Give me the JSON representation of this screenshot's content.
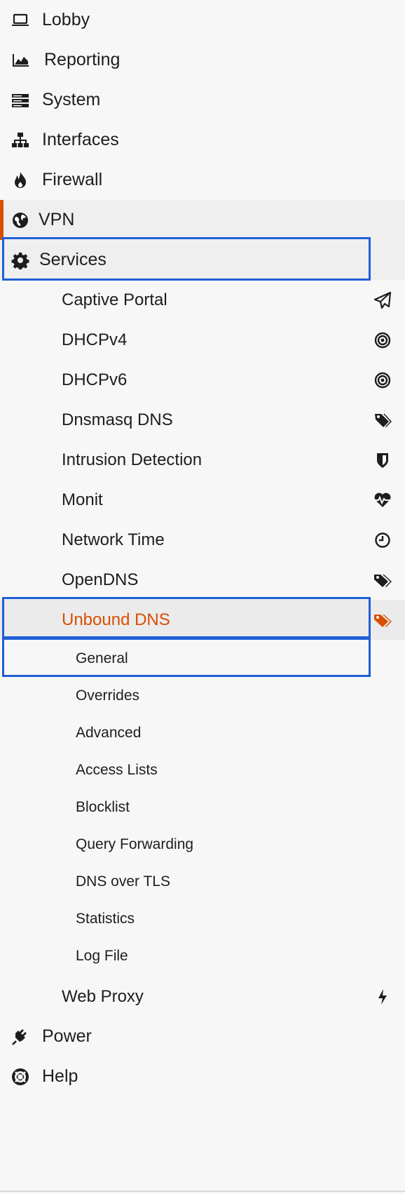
{
  "menu": {
    "lobby": "Lobby",
    "reporting": "Reporting",
    "system": "System",
    "interfaces": "Interfaces",
    "firewall": "Firewall",
    "vpn": "VPN",
    "services": "Services",
    "power": "Power",
    "help": "Help"
  },
  "services": {
    "captive_portal": "Captive Portal",
    "dhcpv4": "DHCPv4",
    "dhcpv6": "DHCPv6",
    "dnsmasq": "Dnsmasq DNS",
    "intrusion": "Intrusion Detection",
    "monit": "Monit",
    "network_time": "Network Time",
    "opendns": "OpenDNS",
    "unbound": "Unbound DNS",
    "web_proxy": "Web Proxy"
  },
  "unbound_items": {
    "general": "General",
    "overrides": "Overrides",
    "advanced": "Advanced",
    "access_lists": "Access Lists",
    "blocklist": "Blocklist",
    "query_forwarding": "Query Forwarding",
    "dns_over_tls": "DNS over TLS",
    "statistics": "Statistics",
    "log_file": "Log File"
  },
  "colors": {
    "accent": "#d94f00",
    "highlight_box": "#1f5fd6"
  },
  "icons": {
    "lobby": "laptop-icon",
    "reporting": "area-chart-icon",
    "system": "server-icon",
    "interfaces": "sitemap-icon",
    "firewall": "fire-icon",
    "vpn": "globe-icon",
    "services": "gear-icon",
    "captive_portal": "paper-plane-icon",
    "dhcp": "bullseye-icon",
    "tag": "tag-icon",
    "shield": "shield-icon",
    "heartbeat": "heartbeat-icon",
    "clock": "clock-icon",
    "tags": "tags-icon",
    "bolt": "bolt-icon",
    "power": "plug-icon",
    "help": "life-ring-icon"
  }
}
